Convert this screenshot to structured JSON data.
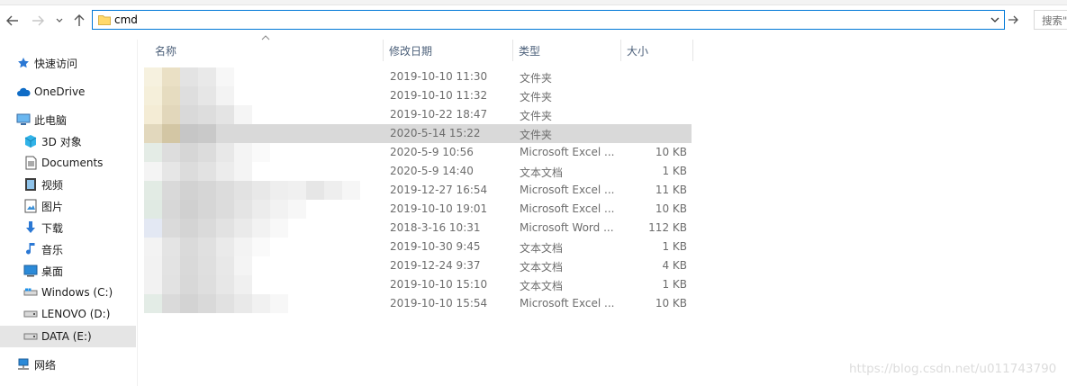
{
  "address": {
    "value": "cmd"
  },
  "search": {
    "placeholder": "搜索\""
  },
  "columns": {
    "name": "名称",
    "date": "修改日期",
    "type": "类型",
    "size": "大小"
  },
  "sidebar": {
    "items": [
      {
        "label": "快速访问",
        "icon": "quick-access-star-icon"
      },
      {
        "label": "OneDrive",
        "icon": "onedrive-cloud-icon"
      },
      {
        "label": "此电脑",
        "icon": "this-pc-monitor-icon"
      },
      {
        "label": "3D 对象",
        "icon": "3d-objects-icon"
      },
      {
        "label": "Documents",
        "icon": "documents-icon"
      },
      {
        "label": "视频",
        "icon": "videos-icon"
      },
      {
        "label": "图片",
        "icon": "pictures-icon"
      },
      {
        "label": "下载",
        "icon": "downloads-arrow-icon"
      },
      {
        "label": "音乐",
        "icon": "music-note-icon"
      },
      {
        "label": "桌面",
        "icon": "desktop-icon"
      },
      {
        "label": "Windows (C:)",
        "icon": "drive-icon"
      },
      {
        "label": "LENOVO (D:)",
        "icon": "drive-icon"
      },
      {
        "label": "DATA (E:)",
        "icon": "drive-icon"
      },
      {
        "label": "网络",
        "icon": "network-icon"
      }
    ]
  },
  "files": [
    {
      "date": "2019-10-10 11:30",
      "type": "文件夹",
      "size": ""
    },
    {
      "date": "2019-10-10 11:32",
      "type": "文件夹",
      "size": ""
    },
    {
      "date": "2019-10-22 18:47",
      "type": "文件夹",
      "size": ""
    },
    {
      "date": "2020-5-14 15:22",
      "type": "文件夹",
      "size": ""
    },
    {
      "date": "2020-5-9 10:56",
      "type": "Microsoft Excel ...",
      "size": "10 KB"
    },
    {
      "date": "2020-5-9 14:40",
      "type": "文本文档",
      "size": "1 KB"
    },
    {
      "date": "2019-12-27 16:54",
      "type": "Microsoft Excel ...",
      "size": "11 KB"
    },
    {
      "date": "2019-10-10 19:01",
      "type": "Microsoft Excel ...",
      "size": "10 KB"
    },
    {
      "date": "2018-3-16 10:31",
      "type": "Microsoft Word ...",
      "size": "112 KB"
    },
    {
      "date": "2019-10-30 9:45",
      "type": "文本文档",
      "size": "1 KB"
    },
    {
      "date": "2019-12-24 9:37",
      "type": "文本文档",
      "size": "4 KB"
    },
    {
      "date": "2019-10-10 15:10",
      "type": "文本文档",
      "size": "1 KB"
    },
    {
      "date": "2019-10-10 15:54",
      "type": "Microsoft Excel ...",
      "size": "10 KB"
    }
  ],
  "watermark": "https://blog.csdn.net/u011743790",
  "colors": {
    "accent": "#0078d7",
    "selected_row": "#d9d9d9",
    "selected_nav": "#cce8ff"
  }
}
